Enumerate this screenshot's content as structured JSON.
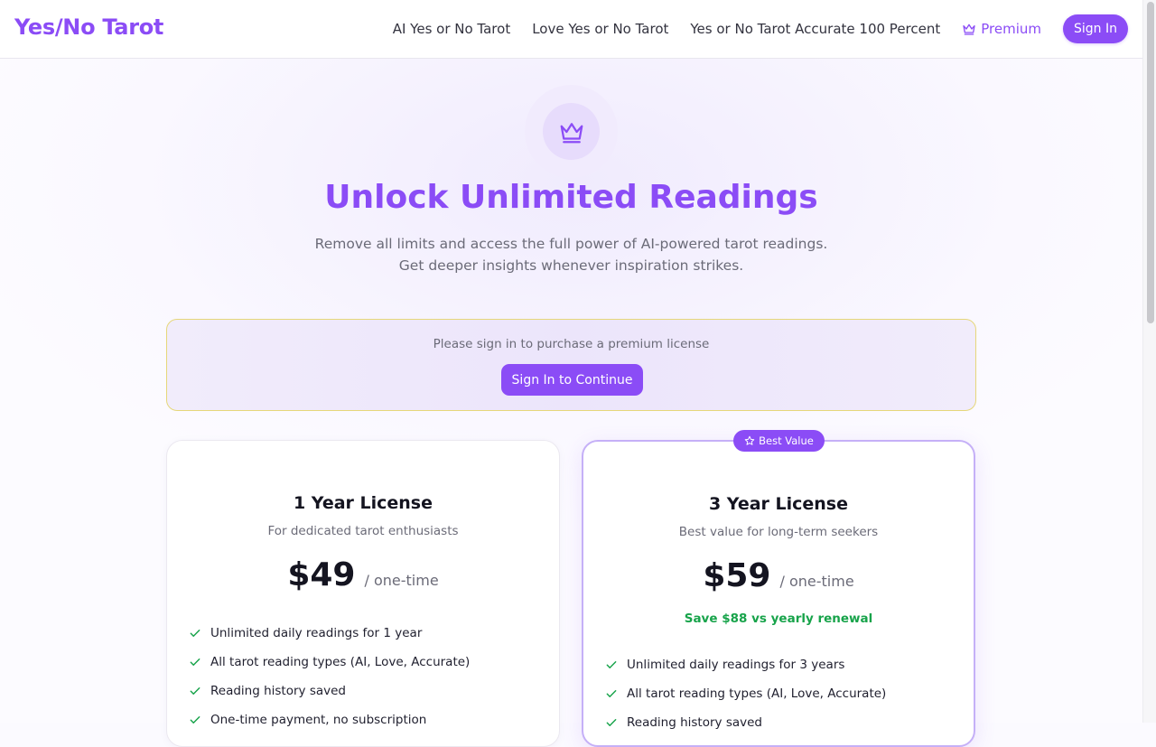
{
  "header": {
    "logo": "Yes/No Tarot",
    "nav": [
      {
        "label": "AI Yes or No Tarot"
      },
      {
        "label": "Love Yes or No Tarot"
      },
      {
        "label": "Yes or No Tarot Accurate 100 Percent"
      }
    ],
    "premium_label": "Premium",
    "premium_icon": "crown-icon",
    "signin_label": "Sign In"
  },
  "hero": {
    "icon": "crown-icon",
    "title": "Unlock Unlimited Readings",
    "subtitle_line1": "Remove all limits and access the full power of AI-powered tarot readings.",
    "subtitle_line2": "Get deeper insights whenever inspiration strikes."
  },
  "notice": {
    "text": "Please sign in to purchase a premium license",
    "button_label": "Sign In to Continue"
  },
  "plans": [
    {
      "title": "1 Year License",
      "description": "For dedicated tarot enthusiasts",
      "price": "$49",
      "period": "/ one-time",
      "features": [
        "Unlimited daily readings for 1 year",
        "All tarot reading types (AI, Love, Accurate)",
        "Reading history saved",
        "One-time payment, no subscription"
      ]
    },
    {
      "badge": "Best Value",
      "badge_icon": "star-icon",
      "title": "3 Year License",
      "description": "Best value for long-term seekers",
      "price": "$59",
      "period": "/ one-time",
      "savings": "Save $88 vs yearly renewal",
      "features": [
        "Unlimited daily readings for 3 years",
        "All tarot reading types (AI, Love, Accurate)",
        "Reading history saved"
      ]
    }
  ],
  "colors": {
    "accent": "#8b4cf6",
    "success": "#17a34a",
    "notice_border": "#e6d77a"
  }
}
